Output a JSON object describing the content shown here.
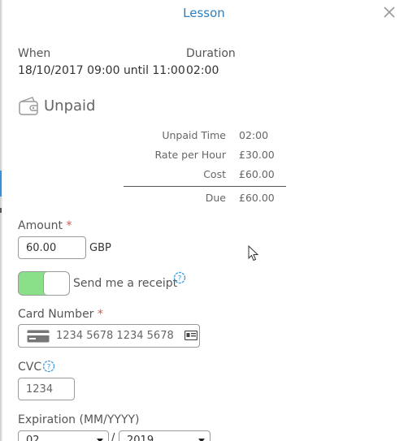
{
  "header": {
    "title": "Lesson"
  },
  "lesson": {
    "when_label": "When",
    "when_value": "18/10/2017 09:00 until 11:00",
    "duration_label": "Duration",
    "duration_value": "02:00"
  },
  "payment": {
    "status": "Unpaid",
    "summary": [
      {
        "label": "Unpaid Time",
        "value": "02:00"
      },
      {
        "label": "Rate per Hour",
        "value": "£30.00"
      },
      {
        "label": "Cost",
        "value": "£60.00"
      }
    ],
    "due_label": "Due",
    "due_value": "£60.00"
  },
  "form": {
    "amount_label": "Amount",
    "required_mark": "*",
    "amount_value": "60.00",
    "currency": "GBP",
    "receipt_label": "Send me a receipt",
    "receipt_enabled": true,
    "card_number_label": "Card Number",
    "card_number_placeholder": "1234 5678 1234 5678",
    "cvc_label": "CVC",
    "cvc_placeholder": "1234",
    "expiration_label": "Expiration (MM/YYYY)",
    "expiration_month": "02",
    "expiration_separator": "/",
    "expiration_year": "2019"
  },
  "colors": {
    "title": "#2a7fc1",
    "toggle_on": "#89e089",
    "required": "#d9534f",
    "help_icon": "#3b9fe0"
  }
}
